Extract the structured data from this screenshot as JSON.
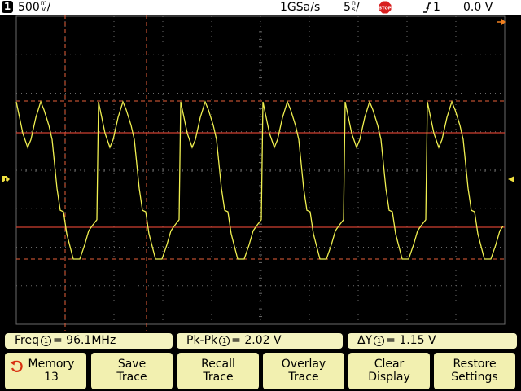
{
  "status": {
    "channel_badge": "1",
    "vdiv_value": "500",
    "vdiv_unit_top": "m",
    "vdiv_unit_bottom": "V",
    "vdiv_slash": "/",
    "sample_rate": "1GSa/s",
    "timebase_value": "5",
    "timebase_unit_top": "n",
    "timebase_unit_bottom": "s",
    "timebase_slash": "/",
    "stop_label": "STOP",
    "trigger_channel": "1",
    "trigger_level": "0.0 V"
  },
  "colors": {
    "trace": "#f0f050",
    "cursor_dashed": "#e8603a",
    "cursor_solid": "#d04030",
    "grid": "#6a6a6a",
    "status_bg": "#ffffff",
    "softkey_bg": "#f2f0b0",
    "stop_red": "#d82020",
    "marker_orange": "#f08020",
    "marker_yellow": "#f0e040"
  },
  "measurements": {
    "freq_label": "Freq",
    "freq_channel": "1",
    "freq_value": "= 96.1MHz",
    "pkpk_label": "Pk-Pk",
    "pkpk_channel": "1",
    "pkpk_value": "=  2.02 V",
    "dy_label": "ΔY",
    "dy_channel": "1",
    "dy_value": "=  1.15  V"
  },
  "softkeys": [
    {
      "line1": "Memory",
      "line2": "13",
      "icon": "undo-icon"
    },
    {
      "line1": "Save",
      "line2": "Trace"
    },
    {
      "line1": "Recall",
      "line2": "Trace"
    },
    {
      "line1": "Overlay",
      "line2": "Trace"
    },
    {
      "line1": "Clear",
      "line2": "Display"
    },
    {
      "line1": "Restore",
      "line2": "Settings"
    }
  ],
  "left_markers": {
    "ground_marker": "1"
  }
}
